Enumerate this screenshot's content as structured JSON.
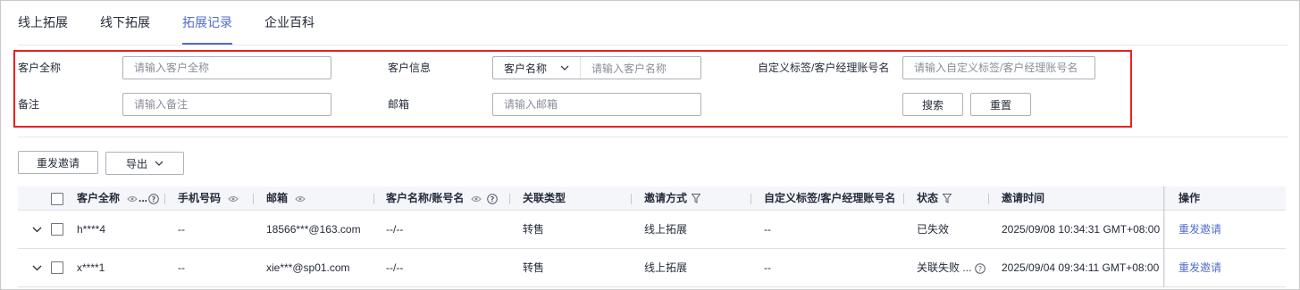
{
  "tabs": [
    "线上拓展",
    "线下拓展",
    "拓展记录",
    "企业百科"
  ],
  "filters": {
    "customer_full_name": {
      "label": "客户全称",
      "placeholder": "请输入客户全称"
    },
    "customer_info": {
      "label": "客户信息",
      "select_value": "客户名称",
      "placeholder": "请输入客户名称"
    },
    "custom_tag": {
      "label": "自定义标签/客户经理账号名",
      "placeholder": "请输入自定义标签/客户经理账号名"
    },
    "remark": {
      "label": "备注",
      "placeholder": "请输入备注"
    },
    "email": {
      "label": "邮箱",
      "placeholder": "请输入邮箱"
    },
    "search_button": "搜索",
    "reset_button": "重置"
  },
  "toolbar": {
    "resend_button": "重发邀请",
    "export_button": "导出"
  },
  "table": {
    "columns": {
      "customer_full_name": "客户全称",
      "customer_full_name_suffix": "...",
      "phone": "手机号码",
      "email": "邮箱",
      "account": "客户名称/账号名",
      "relation_type": "关联类型",
      "invite_method": "邀请方式",
      "custom_tag": "自定义标签/客户经理账号名",
      "status": "状态",
      "invite_time": "邀请时间",
      "operation": "操作"
    },
    "rows": [
      {
        "customer_full_name": "h****4",
        "phone": "--",
        "email": "18566***@163.com",
        "account": "--/--",
        "relation_type": "转售",
        "invite_method": "线上拓展",
        "custom_tag": "--",
        "status": "已失效",
        "status_has_help": false,
        "invite_time": "2025/09/08 10:34:31 GMT+08:00",
        "operation": "重发邀请"
      },
      {
        "customer_full_name": "x****1",
        "phone": "--",
        "email": "xie***@sp01.com",
        "account": "--/--",
        "relation_type": "转售",
        "invite_method": "线上拓展",
        "custom_tag": "--",
        "status": "关联失败 ...",
        "status_has_help": true,
        "invite_time": "2025/09/04 09:34:11 GMT+08:00",
        "operation": "重发邀请"
      }
    ]
  },
  "colors": {
    "accent": "#526ecc",
    "highlight_border": "#e8201e",
    "header_bg": "#f4f6fa"
  }
}
